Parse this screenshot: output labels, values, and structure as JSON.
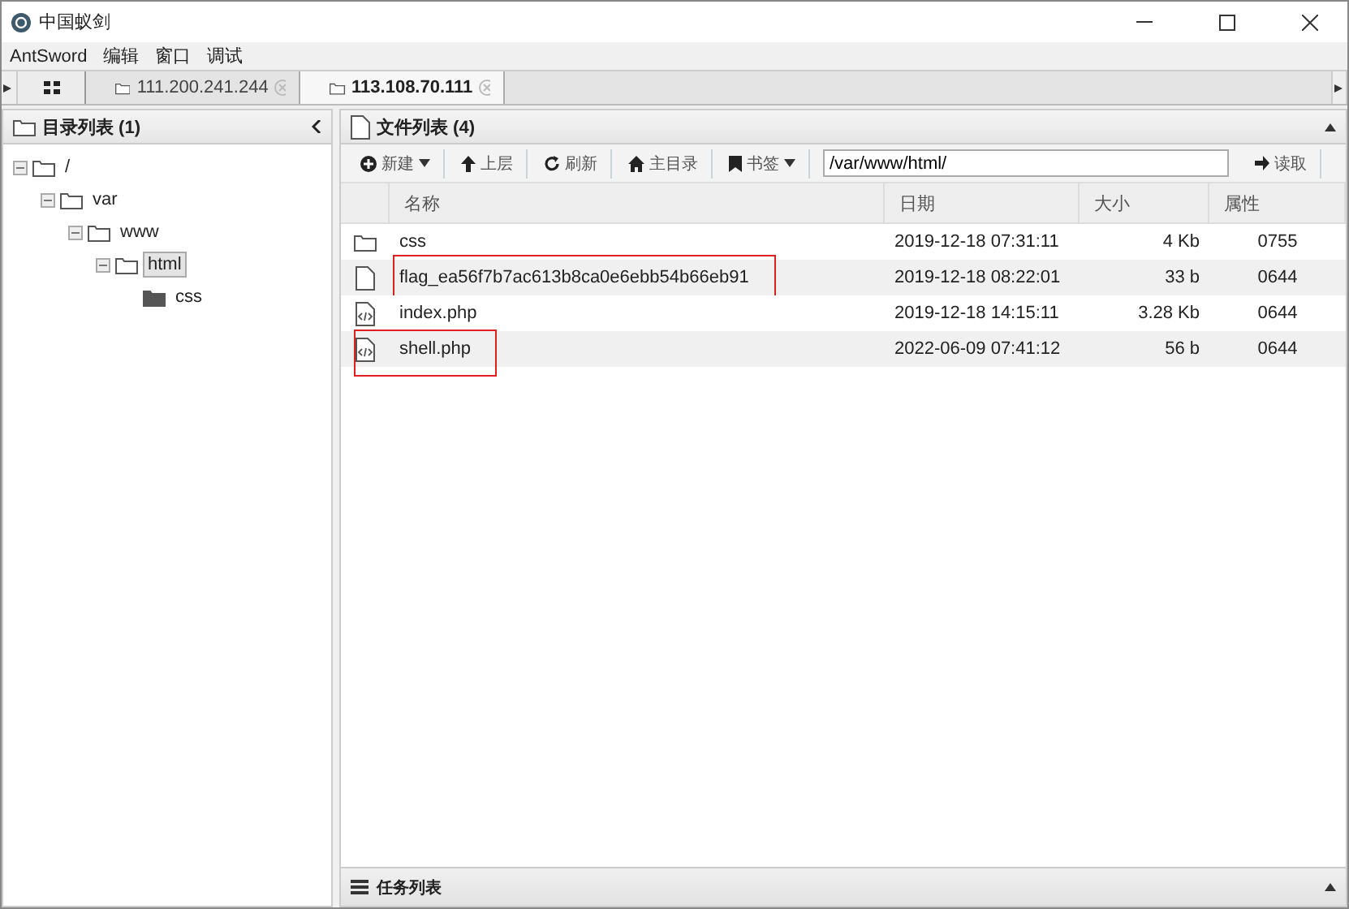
{
  "window": {
    "title": "中国蚁剑"
  },
  "menu": [
    "AntSword",
    "编辑",
    "窗口",
    "调试"
  ],
  "tabs": [
    {
      "label": "111.200.241.244",
      "selected": false
    },
    {
      "label": "113.108.70.111",
      "selected": true
    }
  ],
  "dir_panel": {
    "title": "目录列表 (1)",
    "tree": [
      {
        "name": "/",
        "expanded": true,
        "selected": false,
        "children": [
          {
            "name": "var",
            "expanded": true,
            "selected": false,
            "children": [
              {
                "name": "www",
                "expanded": true,
                "selected": false,
                "children": [
                  {
                    "name": "html",
                    "expanded": true,
                    "selected": true,
                    "children": [
                      {
                        "name": "css",
                        "expanded": false,
                        "selected": false
                      }
                    ]
                  }
                ]
              }
            ]
          }
        ]
      }
    ]
  },
  "file_panel": {
    "title": "文件列表 (4)",
    "toolbar": [
      {
        "label": "新建",
        "dropdown": true
      },
      {
        "label": "上层",
        "dropdown": false
      },
      {
        "label": "刷新",
        "dropdown": false
      },
      {
        "label": "主目录",
        "dropdown": false
      },
      {
        "label": "书签",
        "dropdown": true
      }
    ],
    "path": "/var/www/html/",
    "read_button": "读取",
    "columns": [
      "名称",
      "日期",
      "大小",
      "属性"
    ],
    "rows": [
      {
        "kind": "folder",
        "name": "css",
        "date": "2019-12-18 07:31:11",
        "size": "4 Kb",
        "perm": "0755",
        "highlighted": false
      },
      {
        "kind": "file",
        "name": "flag_ea56f7b7ac613b8ca0e6ebb54b66eb91",
        "date": "2019-12-18 08:22:01",
        "size": "33 b",
        "perm": "0644",
        "highlighted": true
      },
      {
        "kind": "code",
        "name": "index.php",
        "date": "2019-12-18 14:15:11",
        "size": "3.28 Kb",
        "perm": "0644",
        "highlighted": false
      },
      {
        "kind": "code",
        "name": "shell.php",
        "date": "2022-06-09 07:41:12",
        "size": "56 b",
        "perm": "0644",
        "highlighted": true
      }
    ]
  },
  "task_panel": {
    "title": "任务列表"
  }
}
